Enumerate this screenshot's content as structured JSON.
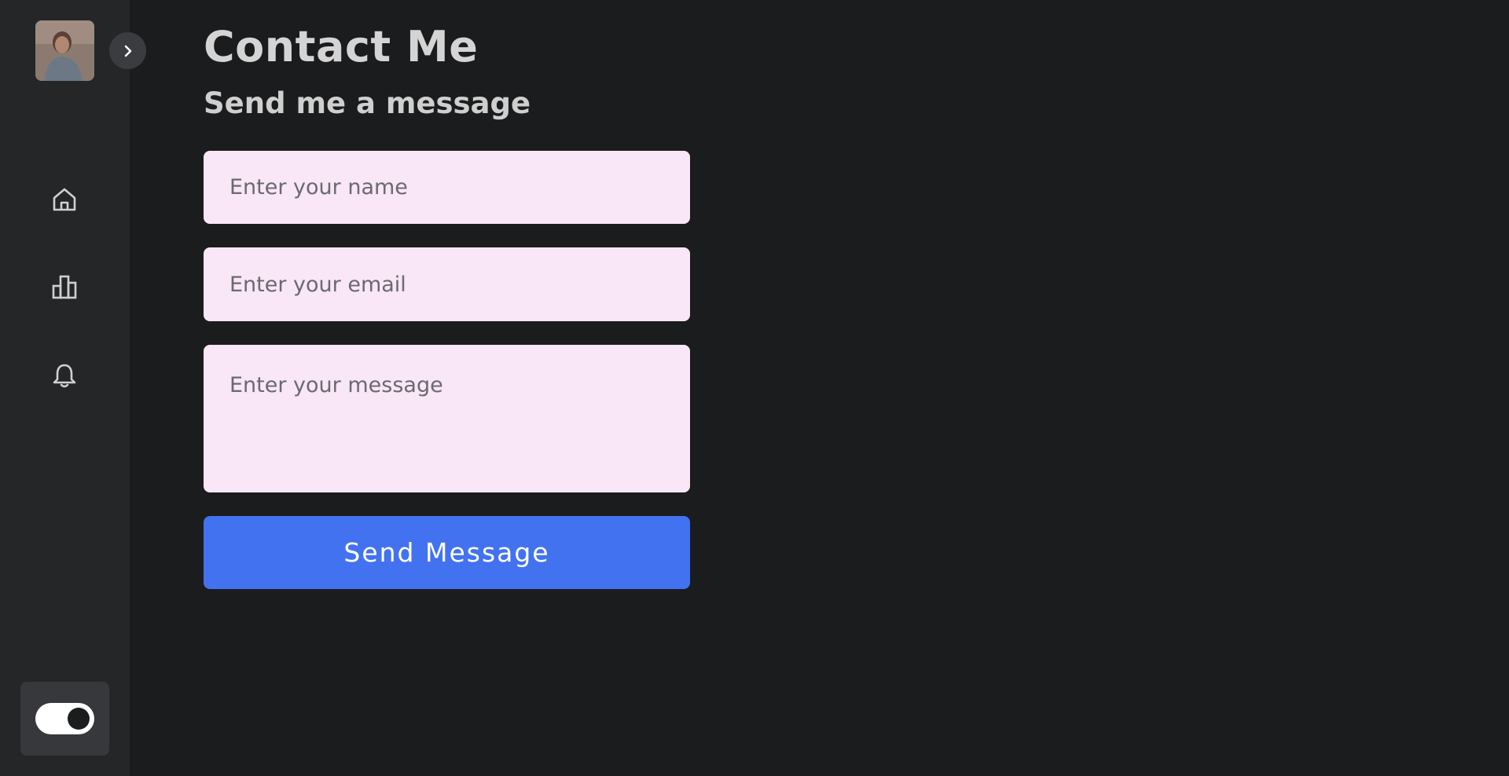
{
  "sidebar": {
    "avatar_alt": "profile photo",
    "nav_items": [
      {
        "name": "home",
        "icon": "home-icon"
      },
      {
        "name": "stats",
        "icon": "bar-chart-icon"
      },
      {
        "name": "notifications",
        "icon": "bell-icon"
      }
    ],
    "collapse_icon": "chevron-right-icon",
    "theme_toggle": {
      "state": "on"
    }
  },
  "main": {
    "title": "Contact Me",
    "subtitle": "Send me a message",
    "form": {
      "name_placeholder": "Enter your name",
      "email_placeholder": "Enter your email",
      "message_placeholder": "Enter your message",
      "submit_label": "Send Message"
    }
  },
  "colors": {
    "background": "#1a1c1e",
    "sidebar": "#242628",
    "input_bg": "#f9e6f7",
    "accent": "#4272f0"
  }
}
